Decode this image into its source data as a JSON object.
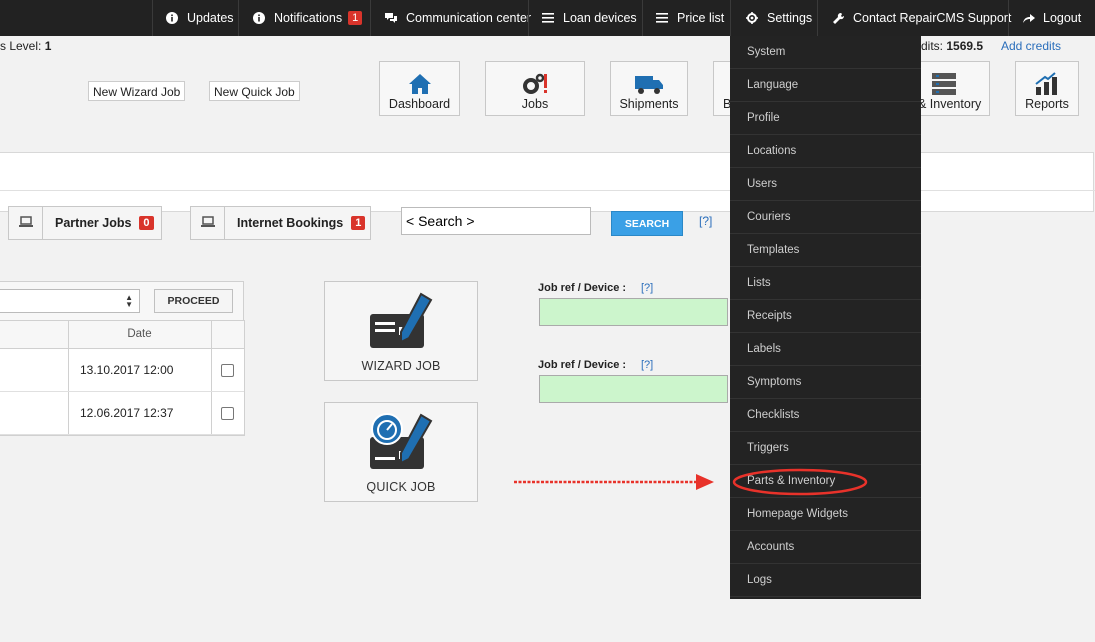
{
  "topbar": {
    "updates": "Updates",
    "notifications": "Notifications",
    "notifications_count": "1",
    "communication": "Communication center",
    "loan_devices": "Loan devices",
    "price_list": "Price list",
    "settings": "Settings",
    "support": "Contact RepairCMS Support",
    "logout": "Logout"
  },
  "header": {
    "level_label": "s Level:",
    "level_value": "1",
    "credits_label": "dits:",
    "credits_value": "1569.5",
    "add_credits": "Add credits",
    "new_wizard_job": "New Wizard Job",
    "new_quick_job": "New Quick Job"
  },
  "nav": {
    "dashboard": "Dashboard",
    "jobs": "Jobs",
    "shipments": "Shipments",
    "partial_b": "B",
    "inventory": "& Inventory",
    "reports": "Reports"
  },
  "tabs": {
    "partner_jobs": "Partner Jobs",
    "partner_count": "0",
    "internet_bookings": "Internet Bookings",
    "internet_count": "1"
  },
  "search": {
    "value": "< Search >",
    "button": "SEARCH",
    "help": "[?]"
  },
  "table": {
    "proceed": "PROCEED",
    "date_header": "Date",
    "rows": [
      {
        "date": "13.10.2017 12:00"
      },
      {
        "date": "12.06.2017 12:37"
      }
    ]
  },
  "actions": {
    "wizard_job": "WIZARD JOB",
    "quick_job": "QUICK JOB",
    "job_ref_label": "Job ref / Device :",
    "job_ref_help": "[?]"
  },
  "settings_menu": [
    "System",
    "Language",
    "Profile",
    "Locations",
    "Users",
    "Couriers",
    "Templates",
    "Lists",
    "Receipts",
    "Labels",
    "Symptoms",
    "Checklists",
    "Triggers",
    "Parts & Inventory",
    "Homepage Widgets",
    "Accounts",
    "Logs"
  ],
  "colors": {
    "topbar": "#222222",
    "accent": "#3aa0e6",
    "badge": "#d9342b",
    "annotation": "#e8322a"
  }
}
